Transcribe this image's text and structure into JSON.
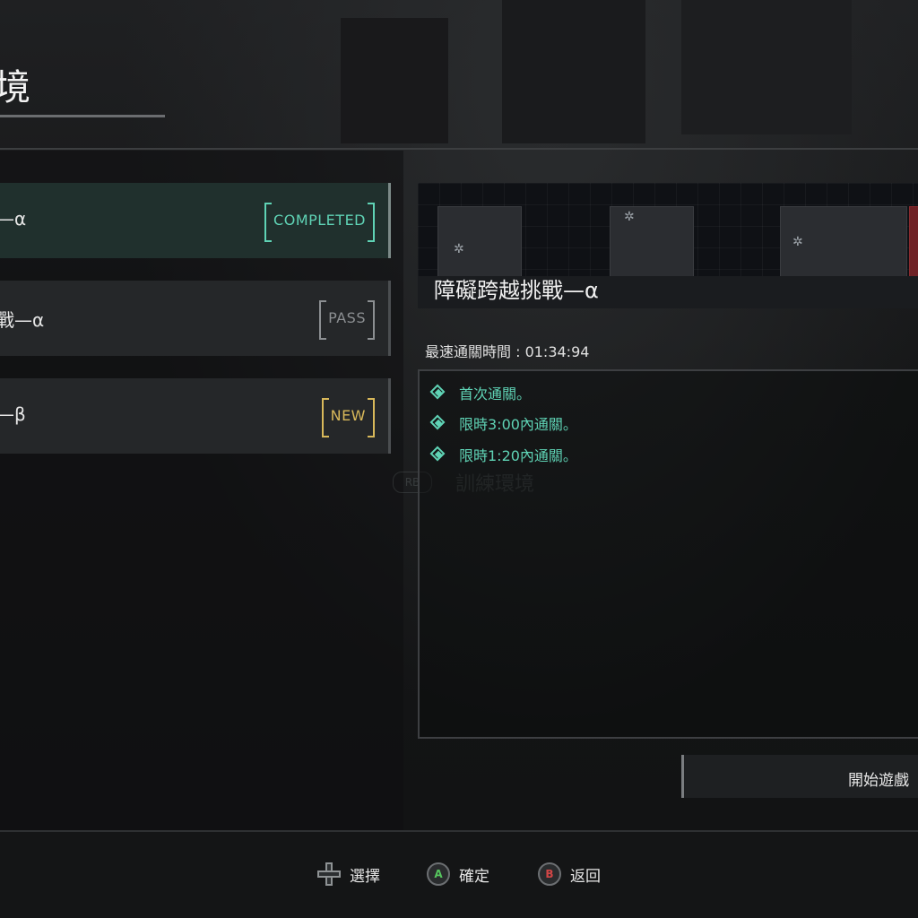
{
  "screen": {
    "title": "境"
  },
  "stage_list": [
    {
      "name": "—α",
      "status": "COMPLETED",
      "selected": true
    },
    {
      "name": "戰—α",
      "status": "PASS",
      "selected": false
    },
    {
      "name": "—β",
      "status": "NEW",
      "selected": false
    }
  ],
  "detail": {
    "title": "障礙跨越挑戰—α",
    "best_time": "最速通關時間 : 01:34:94",
    "goals": [
      "首次通關。",
      "限時3:00內通關。",
      "限時1:20內通關。"
    ],
    "start_label": "開始遊戲"
  },
  "background_hint": {
    "button": "RB",
    "label": "訓練環境"
  },
  "footer": {
    "hints": [
      {
        "icon": "dpad-icon",
        "label": "選擇"
      },
      {
        "icon": "a-button-icon",
        "key": "A",
        "label": "確定"
      },
      {
        "icon": "b-button-icon",
        "key": "B",
        "label": "返回"
      }
    ]
  },
  "colors": {
    "completed": "#5fd3b5",
    "pass": "#8c8f92",
    "new": "#d8b85a",
    "goal": "#5fd3b5"
  }
}
